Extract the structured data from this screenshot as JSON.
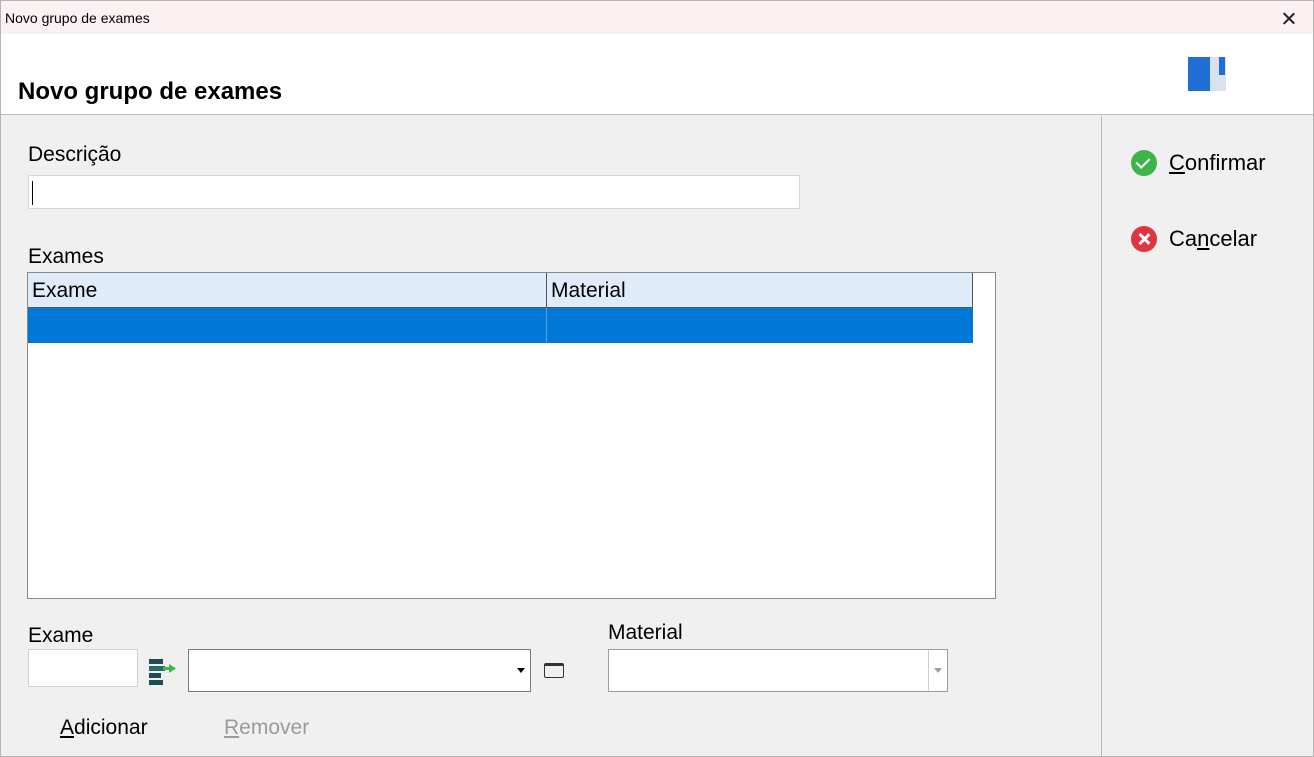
{
  "window": {
    "title": "Novo grupo de exames"
  },
  "header": {
    "title": "Novo grupo de exames",
    "icon": "book-icon"
  },
  "form": {
    "descricao_label": "Descrição",
    "descricao_value": "",
    "exames_label": "Exames",
    "grid": {
      "columns": [
        "Exame",
        "Material"
      ],
      "rows": [
        {
          "exame": "",
          "material": "",
          "selected": true
        }
      ]
    },
    "exame_label": "Exame",
    "material_label": "Material",
    "adicionar": {
      "pre": "",
      "u": "A",
      "post": "dicionar"
    },
    "remover": {
      "pre": "",
      "u": "R",
      "post": "emover"
    }
  },
  "actions": {
    "confirmar": {
      "pre": "",
      "u": "C",
      "post": "onfirmar"
    },
    "cancelar": {
      "pre": "Ca",
      "u": "n",
      "post": "celar"
    }
  },
  "colors": {
    "selection": "#0078d7",
    "header_bg": "#e0ebf9",
    "confirm": "#3db54a",
    "cancel": "#e0343f"
  }
}
